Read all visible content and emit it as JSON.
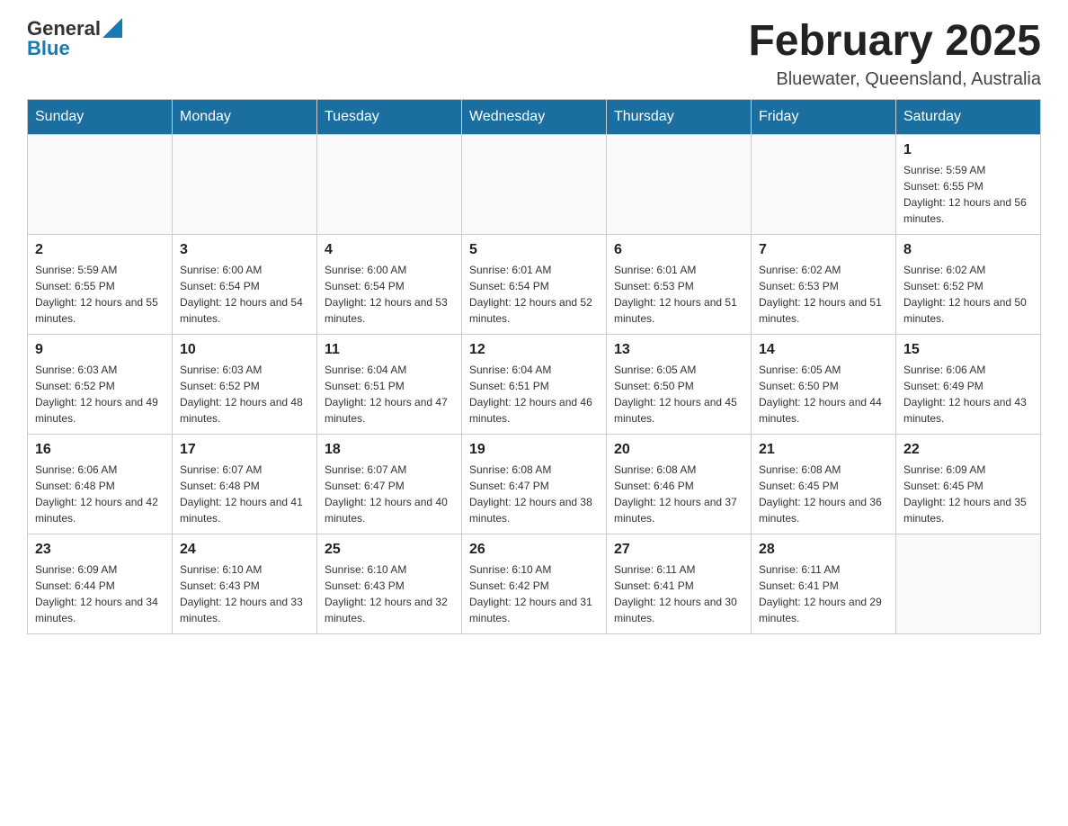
{
  "header": {
    "logo_general": "General",
    "logo_blue": "Blue",
    "month_title": "February 2025",
    "location": "Bluewater, Queensland, Australia"
  },
  "days_of_week": [
    "Sunday",
    "Monday",
    "Tuesday",
    "Wednesday",
    "Thursday",
    "Friday",
    "Saturday"
  ],
  "weeks": [
    [
      {
        "day": "",
        "info": ""
      },
      {
        "day": "",
        "info": ""
      },
      {
        "day": "",
        "info": ""
      },
      {
        "day": "",
        "info": ""
      },
      {
        "day": "",
        "info": ""
      },
      {
        "day": "",
        "info": ""
      },
      {
        "day": "1",
        "info": "Sunrise: 5:59 AM\nSunset: 6:55 PM\nDaylight: 12 hours and 56 minutes."
      }
    ],
    [
      {
        "day": "2",
        "info": "Sunrise: 5:59 AM\nSunset: 6:55 PM\nDaylight: 12 hours and 55 minutes."
      },
      {
        "day": "3",
        "info": "Sunrise: 6:00 AM\nSunset: 6:54 PM\nDaylight: 12 hours and 54 minutes."
      },
      {
        "day": "4",
        "info": "Sunrise: 6:00 AM\nSunset: 6:54 PM\nDaylight: 12 hours and 53 minutes."
      },
      {
        "day": "5",
        "info": "Sunrise: 6:01 AM\nSunset: 6:54 PM\nDaylight: 12 hours and 52 minutes."
      },
      {
        "day": "6",
        "info": "Sunrise: 6:01 AM\nSunset: 6:53 PM\nDaylight: 12 hours and 51 minutes."
      },
      {
        "day": "7",
        "info": "Sunrise: 6:02 AM\nSunset: 6:53 PM\nDaylight: 12 hours and 51 minutes."
      },
      {
        "day": "8",
        "info": "Sunrise: 6:02 AM\nSunset: 6:52 PM\nDaylight: 12 hours and 50 minutes."
      }
    ],
    [
      {
        "day": "9",
        "info": "Sunrise: 6:03 AM\nSunset: 6:52 PM\nDaylight: 12 hours and 49 minutes."
      },
      {
        "day": "10",
        "info": "Sunrise: 6:03 AM\nSunset: 6:52 PM\nDaylight: 12 hours and 48 minutes."
      },
      {
        "day": "11",
        "info": "Sunrise: 6:04 AM\nSunset: 6:51 PM\nDaylight: 12 hours and 47 minutes."
      },
      {
        "day": "12",
        "info": "Sunrise: 6:04 AM\nSunset: 6:51 PM\nDaylight: 12 hours and 46 minutes."
      },
      {
        "day": "13",
        "info": "Sunrise: 6:05 AM\nSunset: 6:50 PM\nDaylight: 12 hours and 45 minutes."
      },
      {
        "day": "14",
        "info": "Sunrise: 6:05 AM\nSunset: 6:50 PM\nDaylight: 12 hours and 44 minutes."
      },
      {
        "day": "15",
        "info": "Sunrise: 6:06 AM\nSunset: 6:49 PM\nDaylight: 12 hours and 43 minutes."
      }
    ],
    [
      {
        "day": "16",
        "info": "Sunrise: 6:06 AM\nSunset: 6:48 PM\nDaylight: 12 hours and 42 minutes."
      },
      {
        "day": "17",
        "info": "Sunrise: 6:07 AM\nSunset: 6:48 PM\nDaylight: 12 hours and 41 minutes."
      },
      {
        "day": "18",
        "info": "Sunrise: 6:07 AM\nSunset: 6:47 PM\nDaylight: 12 hours and 40 minutes."
      },
      {
        "day": "19",
        "info": "Sunrise: 6:08 AM\nSunset: 6:47 PM\nDaylight: 12 hours and 38 minutes."
      },
      {
        "day": "20",
        "info": "Sunrise: 6:08 AM\nSunset: 6:46 PM\nDaylight: 12 hours and 37 minutes."
      },
      {
        "day": "21",
        "info": "Sunrise: 6:08 AM\nSunset: 6:45 PM\nDaylight: 12 hours and 36 minutes."
      },
      {
        "day": "22",
        "info": "Sunrise: 6:09 AM\nSunset: 6:45 PM\nDaylight: 12 hours and 35 minutes."
      }
    ],
    [
      {
        "day": "23",
        "info": "Sunrise: 6:09 AM\nSunset: 6:44 PM\nDaylight: 12 hours and 34 minutes."
      },
      {
        "day": "24",
        "info": "Sunrise: 6:10 AM\nSunset: 6:43 PM\nDaylight: 12 hours and 33 minutes."
      },
      {
        "day": "25",
        "info": "Sunrise: 6:10 AM\nSunset: 6:43 PM\nDaylight: 12 hours and 32 minutes."
      },
      {
        "day": "26",
        "info": "Sunrise: 6:10 AM\nSunset: 6:42 PM\nDaylight: 12 hours and 31 minutes."
      },
      {
        "day": "27",
        "info": "Sunrise: 6:11 AM\nSunset: 6:41 PM\nDaylight: 12 hours and 30 minutes."
      },
      {
        "day": "28",
        "info": "Sunrise: 6:11 AM\nSunset: 6:41 PM\nDaylight: 12 hours and 29 minutes."
      },
      {
        "day": "",
        "info": ""
      }
    ]
  ]
}
